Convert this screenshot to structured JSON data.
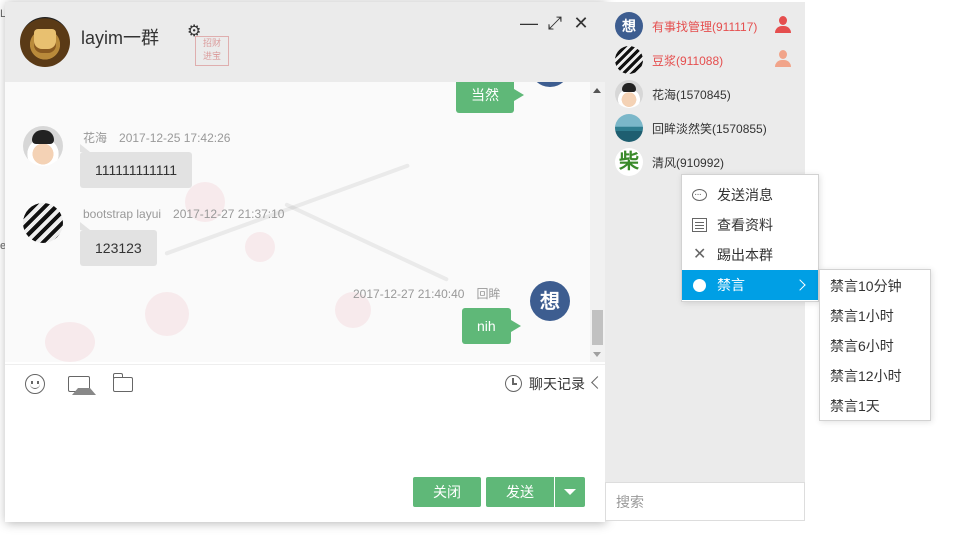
{
  "chat": {
    "group_name": "layim一群",
    "stamp_text": "招财进宝",
    "partial_message": "当然",
    "messages": [
      {
        "user": "花海",
        "time": "2017-12-25 17:42:26",
        "text": "111111111111"
      },
      {
        "user": "bootstrap layui",
        "time": "2017-12-27 21:37:10",
        "text": "123123"
      },
      {
        "user": "回眸",
        "time": "2017-12-27 21:40:40",
        "text": "nih"
      }
    ],
    "avatar_char": "想",
    "history_label": "聊天记录",
    "close_label": "关闭",
    "send_label": "发送"
  },
  "members": [
    {
      "name": "有事找管理(911117)",
      "avatar_char": "想",
      "role": "owner"
    },
    {
      "name": "豆浆(911088)",
      "role": "admin"
    },
    {
      "name": "花海(1570845)"
    },
    {
      "name": "回眸淡然笑(1570855)"
    },
    {
      "name": "清风(910992)",
      "avatar_char": "柴"
    }
  ],
  "search": {
    "placeholder": "搜索"
  },
  "context_menu": {
    "items": [
      "发送消息",
      "查看资料",
      "踢出本群",
      "禁言"
    ],
    "submenu": [
      "禁言10分钟",
      "禁言1小时",
      "禁言6小时",
      "禁言12小时",
      "禁言1天"
    ]
  },
  "colors": {
    "accent_green": "#5fb878",
    "menu_active": "#009fe5",
    "admin_red": "#e54e4e",
    "panel_gray": "#ebebeb"
  },
  "icons": [
    "gear-icon",
    "minimize-icon",
    "maximize-icon",
    "close-icon",
    "emoji-icon",
    "image-icon",
    "folder-icon",
    "clock-icon",
    "chevron-left-icon",
    "user-icon",
    "chat-bubble-icon",
    "profile-card-icon",
    "x-icon",
    "dot-icon",
    "chevron-right-icon"
  ]
}
